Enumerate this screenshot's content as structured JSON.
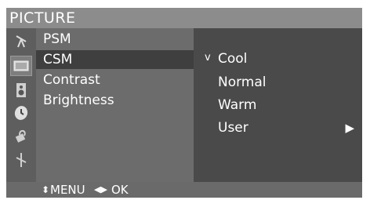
{
  "title": "PICTURE",
  "icons": [
    "antenna-icon",
    "picture-icon",
    "audio-speaker-icon",
    "clock-icon",
    "lock-icon",
    "setup-icon"
  ],
  "menu": {
    "items": [
      {
        "label": "PSM",
        "selected": false
      },
      {
        "label": "CSM",
        "selected": true
      },
      {
        "label": "Contrast",
        "selected": false
      },
      {
        "label": "Brightness",
        "selected": false
      }
    ]
  },
  "submenu": {
    "items": [
      {
        "label": "Cool",
        "checked": true,
        "check_mark": "v",
        "has_arrow": false
      },
      {
        "label": "Normal",
        "checked": false,
        "has_arrow": false
      },
      {
        "label": "Warm",
        "checked": false,
        "has_arrow": false
      },
      {
        "label": "User",
        "checked": false,
        "has_arrow": true,
        "arrow": "▶"
      }
    ]
  },
  "footer": {
    "updown_glyph": "⬍",
    "menu_label": "MENU",
    "leftright_glyph": "◀▶",
    "ok_label": "OK"
  },
  "colors": {
    "title_bar": "#8c8c8c",
    "icon_bar": "#5e5e5e",
    "menu_bg": "#6c6c6c",
    "selected_item": "#3f3f3f",
    "submenu_bg": "#4a4a4a",
    "text": "#ffffff"
  }
}
